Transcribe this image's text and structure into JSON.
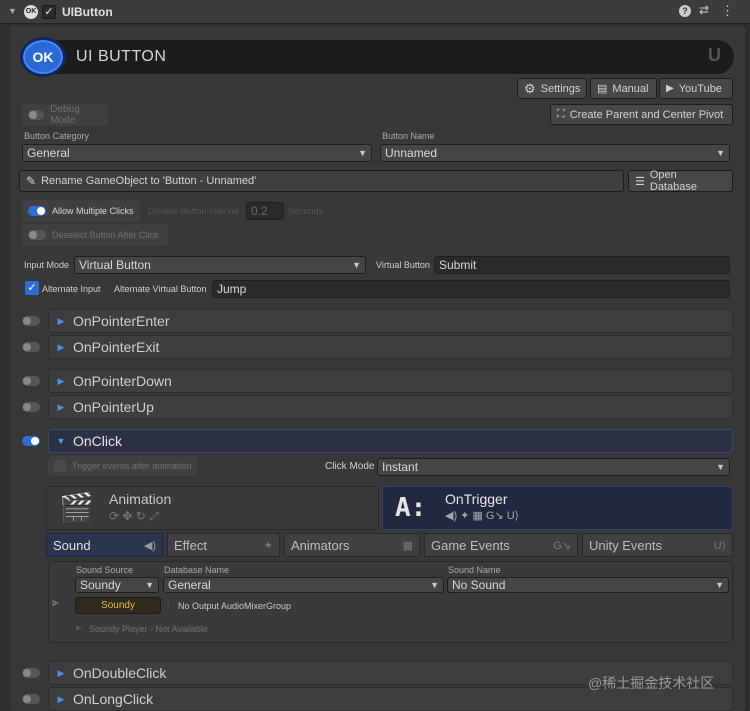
{
  "header": {
    "title": "UIButton"
  },
  "banner": {
    "logo": "OK",
    "title": "UI BUTTON",
    "corner": "U"
  },
  "toolbar": {
    "settings": "Settings",
    "manual": "Manual",
    "youtube": "YouTube",
    "create_parent": "Create Parent and Center Pivot"
  },
  "debug": {
    "label": "Debug Mode"
  },
  "category": {
    "label": "Button Category",
    "value": "General"
  },
  "name": {
    "label": "Button Name",
    "value": "Unnamed"
  },
  "rename": {
    "label": "Rename GameObject to 'Button - Unnamed'",
    "open_db": "Open Database"
  },
  "allow_multiple": {
    "label": "Allow Multiple Clicks",
    "disable_interval_label": "Disable Button Interval",
    "interval": "0.2",
    "unit": "Seconds"
  },
  "deselect": {
    "label": "Deselect Button After Click"
  },
  "input_mode": {
    "label": "Input Mode",
    "value": "Virtual Button",
    "vb_label": "Virtual Button",
    "vb_value": "Submit"
  },
  "alternate": {
    "label": "Alternate Input",
    "avb_label": "Alternate Virtual Button",
    "avb_value": "Jump"
  },
  "events": {
    "pointer_enter": "OnPointerEnter",
    "pointer_exit": "OnPointerExit",
    "pointer_down": "OnPointerDown",
    "pointer_up": "OnPointerUp",
    "on_click": "OnClick",
    "double_click": "OnDoubleClick",
    "long_click": "OnLongClick"
  },
  "onclick": {
    "trigger_after_anim": "Trigger events after animation",
    "click_mode_label": "Click Mode",
    "click_mode_value": "Instant",
    "animation_title": "Animation",
    "ontrigger_title": "OnTrigger",
    "ontrigger_glyph": "A:"
  },
  "tabs": [
    "Sound",
    "Effect",
    "Animators",
    "Game Events",
    "Unity Events"
  ],
  "sound": {
    "source_label": "Sound Source",
    "source_value": "Soundy",
    "db_label": "Database Name",
    "db_value": "General",
    "name_label": "Sound Name",
    "name_value": "No Sound",
    "soundy_button": "Soundy",
    "mixer": "No Output AudioMixerGroup",
    "player": "Soundy Player - Not Available"
  },
  "watermark": "@稀土掘金技术社区",
  "colors": {
    "accent": "#2e6fd6",
    "soundy": "#e6b84a"
  }
}
